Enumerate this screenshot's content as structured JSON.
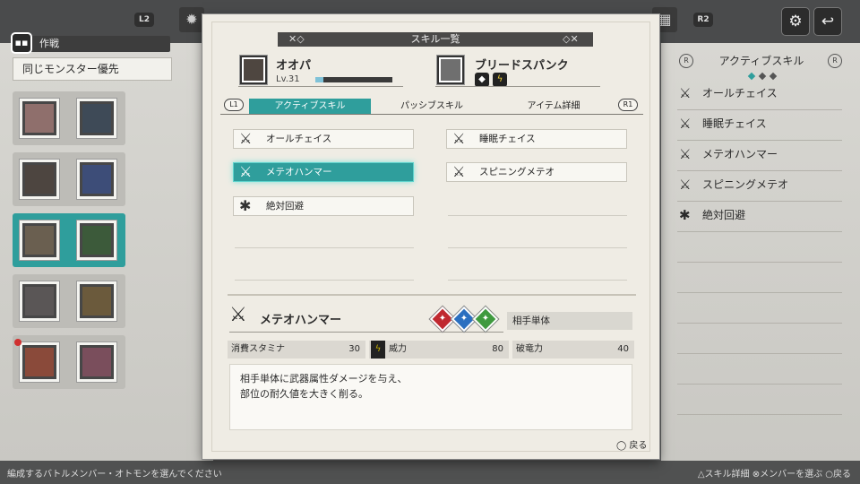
{
  "topbar": {
    "l2": "L2",
    "r2": "R2",
    "tab_icons": [
      "gear-cycle-icon",
      "return-icon"
    ]
  },
  "left": {
    "tactic_label": "作戦",
    "tactic_value": "同じモンスター優先"
  },
  "dialog": {
    "title": "スキル一覧",
    "character": {
      "name": "オオパ",
      "level": "Lv.31",
      "exp_fraction": 0.1
    },
    "weapon": {
      "name": "ブリードスパンク"
    },
    "tabs": {
      "l1": "L1",
      "r1": "R1",
      "items": [
        "アクティブスキル",
        "パッシブスキル",
        "アイテム詳細"
      ],
      "active": 0
    },
    "skills": [
      {
        "label": "オールチェイス",
        "icon": "sword-chase-icon"
      },
      {
        "label": "睡眠チェイス",
        "icon": "sword-chase-icon"
      },
      {
        "label": "メテオハンマー",
        "icon": "sword-chase-icon",
        "selected": true
      },
      {
        "label": "スピニングメテオ",
        "icon": "sword-chase-icon"
      },
      {
        "label": "絶対回避",
        "icon": "dodge-icon"
      }
    ],
    "detail": {
      "name": "メテオハンマー",
      "target": "相手単体",
      "stamina_label": "消費スタミナ",
      "stamina_value": "30",
      "power_label": "威力",
      "power_value": "80",
      "break_label": "破竜力",
      "break_value": "40",
      "description": "相手単体に武器属性ダメージを与え、\n部位の耐久値を大きく削る。",
      "type_colors": [
        "#c0282f",
        "#2a6fc0",
        "#3f9a3f"
      ]
    },
    "back_label": "戻る"
  },
  "right": {
    "title": "アクティブスキル",
    "badge_l": "R",
    "badge_r": "R",
    "items": [
      "オールチェイス",
      "睡眠チェイス",
      "メテオハンマー",
      "スピニングメテオ",
      "絶対回避"
    ]
  },
  "bottom": {
    "hint": "編成するバトルメンバー・オトモンを選んでください",
    "controls": "△スキル詳細 ⊗メンバーを選ぶ ○戻る"
  },
  "colors": {
    "accent": "#2f9e9c",
    "panel": "#efece4"
  }
}
